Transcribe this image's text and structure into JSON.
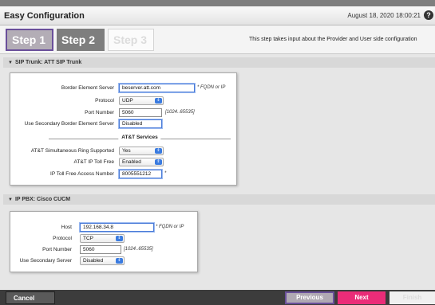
{
  "header": {
    "title": "Easy Configuration",
    "datetime": "August 18, 2020 18:00:21",
    "help_icon": "?"
  },
  "steps": {
    "step1": "Step 1",
    "step2": "Step 2",
    "step3": "Step 3",
    "active": "Step 1",
    "description": "This step takes input about the Provider and User side configuration"
  },
  "sip_trunk": {
    "header": "SIP Trunk: ATT SIP Trunk",
    "fields": {
      "border_server_label": "Border Element Server",
      "border_server_value": "beserver.att.com",
      "border_server_hint": "* FQDN or IP",
      "protocol_label": "Protocol",
      "protocol_value": "UDP",
      "port_label": "Port Number",
      "port_value": "5060",
      "port_hint": "[1024..65535]",
      "secondary_label": "Use Secondary Border Element Server",
      "secondary_value": "Disabled"
    },
    "att_services": {
      "header": "AT&T Services",
      "ring_label": "AT&T Simultaneous Ring Supported",
      "ring_value": "Yes",
      "tollfree_label": "AT&T IP Toll Free",
      "tollfree_value": "Enabled",
      "access_label": "IP Toll Free Access Number",
      "access_value": "8005551212",
      "access_hint": "*"
    }
  },
  "ip_pbx": {
    "header": "IP PBX: Cisco CUCM",
    "fields": {
      "host_label": "Host",
      "host_value": "192.168.34.8",
      "host_hint": "* FQDN or IP",
      "protocol_label": "Protocol",
      "protocol_value": "TCP",
      "port_label": "Port Number",
      "port_value": "5060",
      "port_hint": "[1024..65535]",
      "secondary_label": "Use Secondary Server",
      "secondary_value": "Disabled"
    }
  },
  "footer": {
    "cancel": "Cancel",
    "previous": "Previous",
    "next": "Next",
    "finish": "Finish"
  },
  "colors": {
    "accent_purple": "#6a4f9a",
    "next_pink": "#ea2c78",
    "select_blue": "#3a7be0"
  }
}
